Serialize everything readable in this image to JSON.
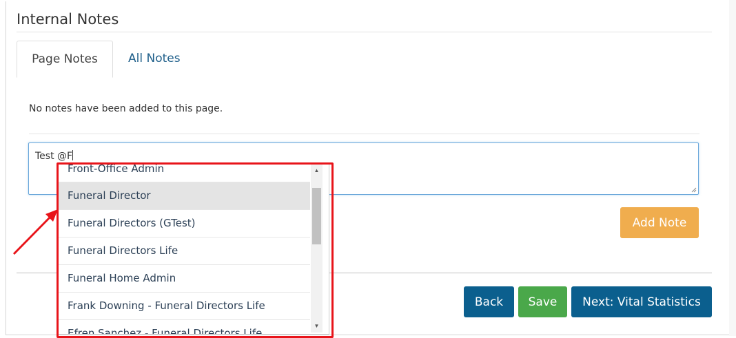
{
  "section": {
    "title": "Internal Notes"
  },
  "tabs": [
    {
      "label": "Page Notes",
      "active": true
    },
    {
      "label": "All Notes",
      "active": false
    }
  ],
  "notes": {
    "empty_message": "No notes have been added to this page."
  },
  "note_input": {
    "value": "Test @F"
  },
  "buttons": {
    "add_note": "Add Note",
    "back": "Back",
    "save": "Save",
    "next": "Next: Vital Statistics"
  },
  "mention_dropdown": {
    "items": [
      "Front-Office Admin",
      "Funeral Director",
      "Funeral Directors (GTest)",
      "Funeral Directors Life",
      "Funeral Home Admin",
      "Frank Downing - Funeral Directors Life",
      "Efren Sanchez - Funeral Directors Life"
    ],
    "highlighted_index": 1
  },
  "colors": {
    "primary": "#0b5f8e",
    "success": "#4aa84a",
    "warning": "#f0ad4e",
    "annotation": "#e8141a",
    "link": "#1f5f8a"
  },
  "icons": {
    "scroll_up": "triangle-up",
    "scroll_down": "triangle-down",
    "resize": "resize-grip"
  }
}
